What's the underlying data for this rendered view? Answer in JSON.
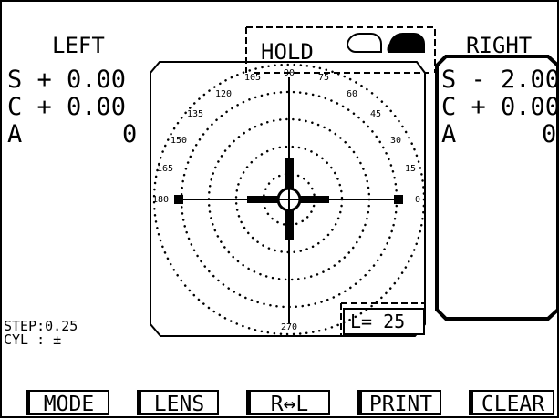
{
  "left": {
    "title": "LEFT",
    "sphere": "S + 0.00",
    "cylinder": "C + 0.00",
    "axis_label": "A",
    "axis_value": "0"
  },
  "right": {
    "title": "RIGHT",
    "sphere": "S - 2.00",
    "cylinder": "C + 0.00",
    "axis_label": "A",
    "axis_value": "0"
  },
  "hold": {
    "label": "HOLD"
  },
  "target": {
    "angle_labels": [
      "0",
      "15",
      "30",
      "45",
      "60",
      "75",
      "90",
      "105",
      "120",
      "135",
      "150",
      "165",
      "180",
      "270"
    ],
    "l_readout": "L= 25"
  },
  "settings": {
    "step": "STEP:0.25",
    "cyl": "CYL : ±"
  },
  "buttons": {
    "mode": "MODE",
    "lens": "LENS",
    "swap": "R↔L",
    "print": "PRINT",
    "clear": "CLEAR"
  },
  "colors": {
    "foreground": "#000000",
    "background": "#ffffff"
  }
}
